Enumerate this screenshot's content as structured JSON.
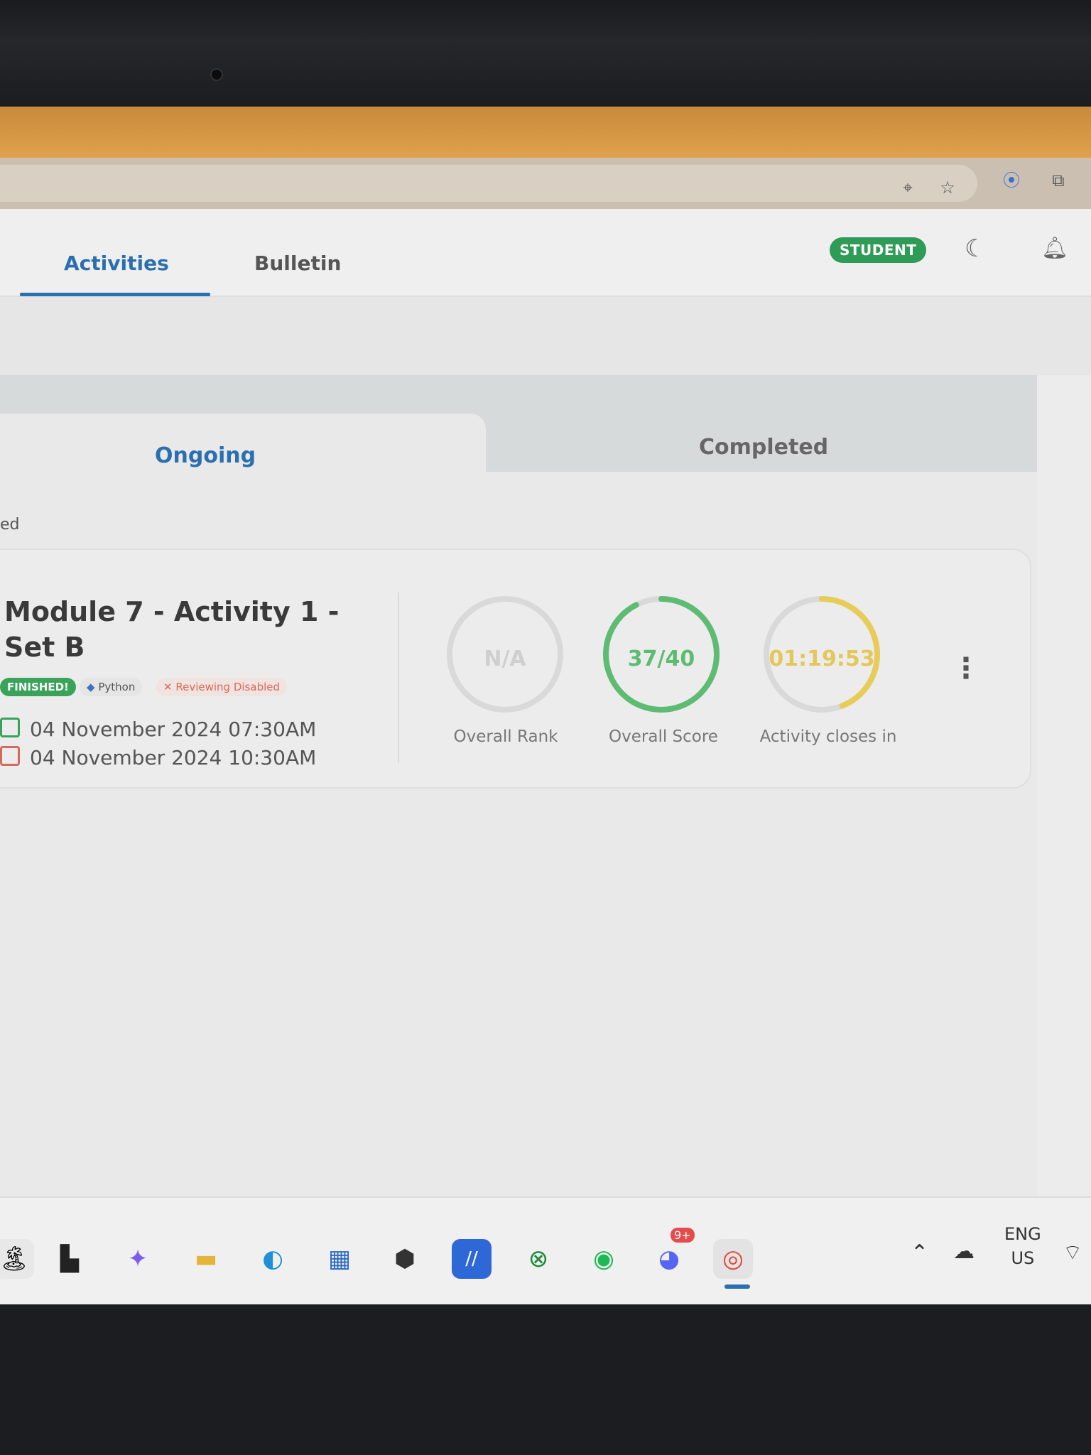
{
  "nav": {
    "tabs": [
      {
        "label": "Activities",
        "active": true
      },
      {
        "label": "Bulletin",
        "active": false
      }
    ],
    "role_badge": "STUDENT",
    "theme_icon": "moon-icon",
    "notification_icon": "bell-icon"
  },
  "address_bar": {
    "icons": [
      "location-icon",
      "star-icon",
      "read-aloud-icon",
      "extensions-icon"
    ]
  },
  "activity_tabs": [
    {
      "label": "Ongoing",
      "active": true
    },
    {
      "label": "Completed",
      "active": false
    }
  ],
  "partial_label": "ed",
  "activity": {
    "title": "Module 7 - Activity 1 - Set B",
    "tags": {
      "status": "FINISHED!",
      "language": "Python",
      "reviewing": "Reviewing Disabled"
    },
    "start": "04 November 2024 07:30AM",
    "end": "04 November 2024 10:30AM",
    "stats": [
      {
        "value": "N/A",
        "label": "Overall Rank",
        "fraction": 0,
        "color": "#cfcfcf"
      },
      {
        "value": "37/40",
        "label": "Overall Score",
        "fraction": 0.925,
        "color": "#5dbb72"
      },
      {
        "value": "01:19:53",
        "label": "Activity closes in",
        "fraction": 0.44,
        "color": "#e8cc5a"
      }
    ]
  },
  "taskbar": {
    "apps": [
      "start-icon",
      "task-view-icon",
      "copilot-icon",
      "file-explorer-icon",
      "edge-icon",
      "store-icon",
      "app-icon",
      "code-editor-icon",
      "xbox-icon",
      "spotify-icon",
      "discord-icon",
      "chrome-icon"
    ],
    "discord_badge": "9+",
    "language": "ENG",
    "region": "US"
  },
  "colors": {
    "accent": "#2b6fb0",
    "success": "#3aa35a",
    "danger": "#d46a5a"
  }
}
